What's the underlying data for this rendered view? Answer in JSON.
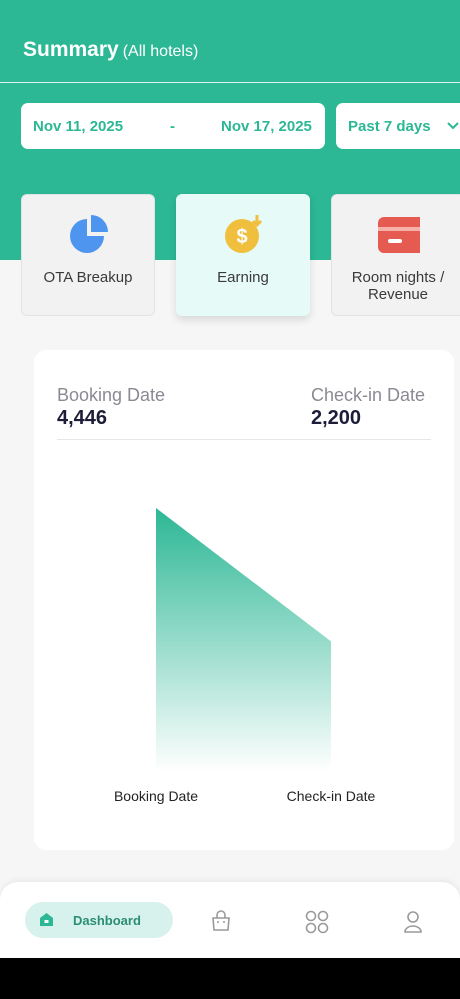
{
  "header": {
    "title": "Summary",
    "subtitle": "(All hotels)"
  },
  "dates": {
    "start": "Nov 11, 2025",
    "separator": "-",
    "end": "Nov 17, 2025",
    "range": "Past 7 days"
  },
  "cards": [
    {
      "label": "OTA Breakup",
      "icon": "pie-chart-icon"
    },
    {
      "label": "Earning",
      "icon": "dollar-coin-icon"
    },
    {
      "label_line1": "Room nights /",
      "label_line2": "Revenue",
      "icon": "credit-card-icon"
    }
  ],
  "stats": {
    "booking": {
      "label": "Booking Date",
      "value": "4,446"
    },
    "checkin": {
      "label": "Check-in Date",
      "value": "2,200"
    }
  },
  "chart_data": {
    "type": "area",
    "categories": [
      "Booking Date",
      "Check-in Date"
    ],
    "values": [
      4446,
      2200
    ],
    "color": "#2cb795"
  },
  "nav": {
    "dashboard": "Dashboard"
  },
  "colors": {
    "accent": "#2cb795",
    "card_active": "#e6faf7",
    "pie": "#4e95f0",
    "coin": "#f1bf3e",
    "card_icon": "#e55b52"
  }
}
